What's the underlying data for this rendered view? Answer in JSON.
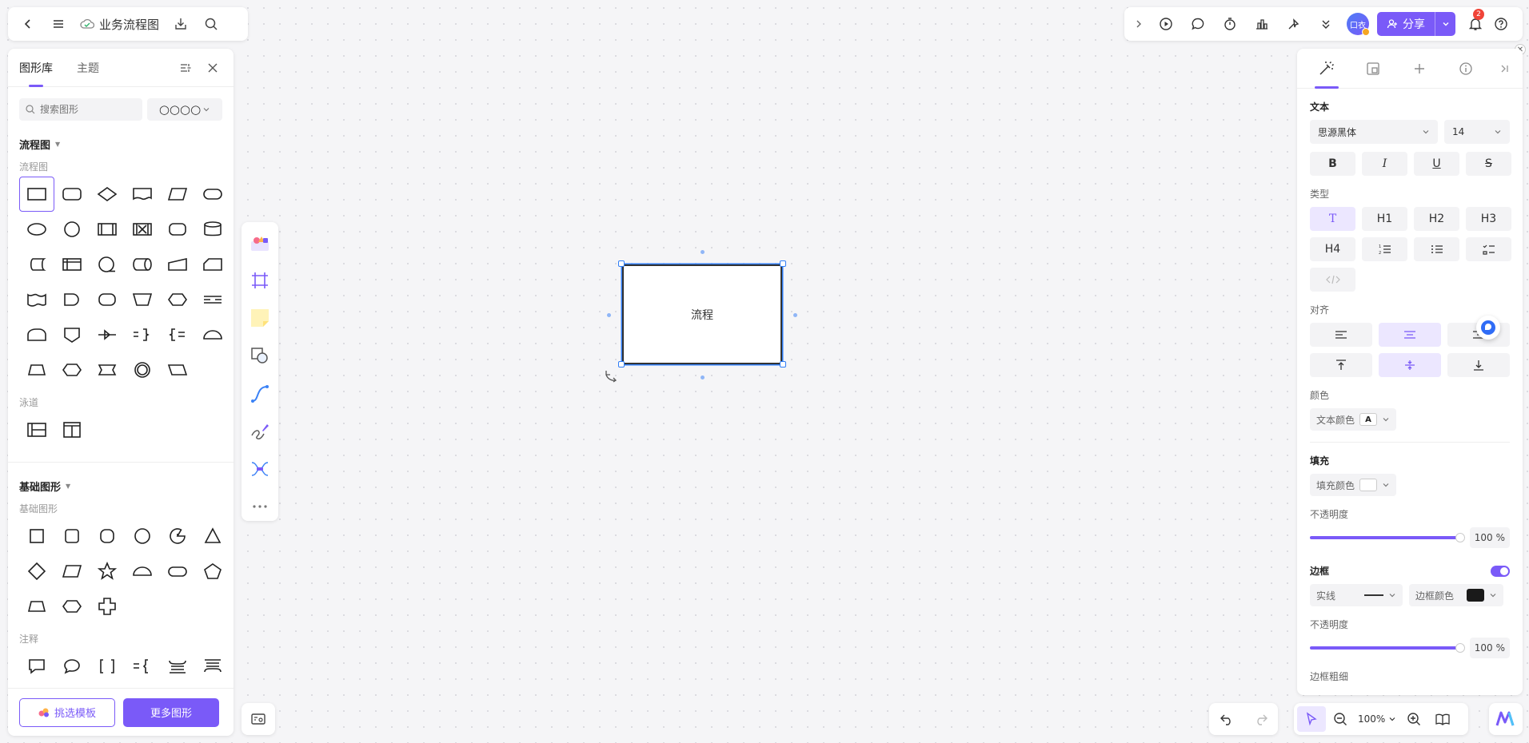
{
  "doc": {
    "title": "业务流程图"
  },
  "header": {
    "share_label": "分享",
    "avatar_text": "口衣",
    "notification_count": "2"
  },
  "library": {
    "tabs": [
      {
        "label": "图形库"
      },
      {
        "label": "主题"
      }
    ],
    "search_placeholder": "搜索图形",
    "style_picker": "○○○○",
    "sections": [
      {
        "title": "流程图",
        "subs": [
          {
            "label": "流程图"
          },
          {
            "label": "泳道"
          }
        ]
      },
      {
        "title": "基础图形",
        "subs": [
          {
            "label": "基础图形"
          },
          {
            "label": "注释"
          }
        ]
      }
    ],
    "template_button": "挑选模板",
    "more_shapes_button": "更多图形"
  },
  "canvas": {
    "shape_text": "流程"
  },
  "props": {
    "text_section": "文本",
    "font_family": "思源黑体",
    "font_size": "14",
    "type_section": "类型",
    "align_section": "对齐",
    "color_section": "颜色",
    "text_color_label": "文本颜色",
    "text_color_glyph": "A",
    "fill_section": "填充",
    "fill_color_label": "填充颜色",
    "opacity_label": "不透明度",
    "fill_opacity": "100",
    "pct": "%",
    "border_section": "边框",
    "border_style": "实线",
    "border_color_label": "边框颜色",
    "border_opacity": "100",
    "border_width_label": "边框粗细",
    "heading_labels": [
      "H1",
      "H2",
      "H3",
      "H4"
    ]
  },
  "zoom": {
    "level": "100%"
  },
  "colors": {
    "accent": "#7a5af8",
    "selection": "#2f7df6",
    "border_color": "#1a1a1a"
  }
}
